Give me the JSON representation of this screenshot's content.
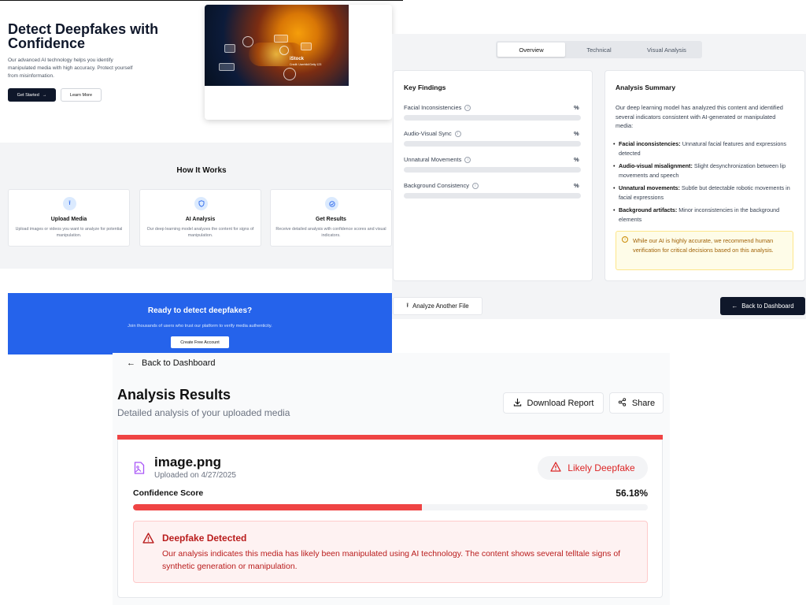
{
  "landing": {
    "hero_title": "Detect Deepfakes with Confidence",
    "hero_desc": "Our advanced AI technology helps you identify manipulated media with high accuracy. Protect yourself from misinformation.",
    "get_started": "Get Started",
    "learn_more": "Learn More",
    "image_watermark": "iStock",
    "image_credit": "Credit: Userbild/Getty 123",
    "how_title": "How It Works",
    "steps": [
      {
        "title": "Upload Media",
        "desc": "Upload images or videos you want to analyze for potential manipulation.",
        "icon": "upload-icon"
      },
      {
        "title": "AI Analysis",
        "desc": "Our deep learning model analyzes the content for signs of manipulation.",
        "icon": "shield-icon"
      },
      {
        "title": "Get Results",
        "desc": "Receive detailed analysis with confidence scores and visual indicators.",
        "icon": "check-circle-icon"
      }
    ],
    "cta_title": "Ready to detect deepfakes?",
    "cta_desc": "Join thousands of users who trust our platform to verify media authenticity.",
    "cta_button": "Create Free Account",
    "colors": {
      "primary_dark": "#0f172a",
      "cta_blue": "#2563eb"
    }
  },
  "overview": {
    "tabs": [
      "Overview",
      "Technical",
      "Visual Analysis"
    ],
    "active_tab": "Overview",
    "findings_title": "Key Findings",
    "findings": [
      {
        "label": "Facial Inconsistencies",
        "value": "%"
      },
      {
        "label": "Audio-Visual Sync",
        "value": "%"
      },
      {
        "label": "Unnatural Movements",
        "value": "%"
      },
      {
        "label": "Background Consistency",
        "value": "%"
      }
    ],
    "summary_title": "Analysis Summary",
    "summary_intro": "Our deep learning model has analyzed this content and identified several indicators consistent with AI-generated or manipulated media:",
    "summary_items": [
      {
        "bold": "Facial inconsistencies:",
        "text": " Unnatural facial features and expressions detected"
      },
      {
        "bold": "Audio-visual misalignment:",
        "text": " Slight desynchronization between lip movements and speech"
      },
      {
        "bold": "Unnatural movements:",
        "text": " Subtle but detectable robotic movements in facial expressions"
      },
      {
        "bold": "Background artifacts:",
        "text": " Minor inconsistencies in the background elements"
      }
    ],
    "note": "While our AI is highly accurate, we recommend human verification for critical decisions based on this analysis.",
    "analyze_another": "Analyze Another File",
    "back_to_dashboard": "Back to Dashboard"
  },
  "results": {
    "back_link": "Back to Dashboard",
    "title": "Analysis Results",
    "subtitle": "Detailed analysis of your uploaded media",
    "download_report": "Download Report",
    "share": "Share",
    "file_name": "image.png",
    "uploaded_on": "Uploaded on 4/27/2025",
    "verdict": "Likely Deepfake",
    "confidence_label": "Confidence Score",
    "confidence_value": "56.18%",
    "confidence_fraction": 0.5618,
    "alert_title": "Deepfake Detected",
    "alert_text": "Our analysis indicates this media has likely been manipulated using AI technology. The content shows several telltale signs of synthetic generation or manipulation.",
    "colors": {
      "danger": "#ef4444",
      "danger_text": "#b91c1c",
      "file_icon": "#a855f7"
    }
  }
}
